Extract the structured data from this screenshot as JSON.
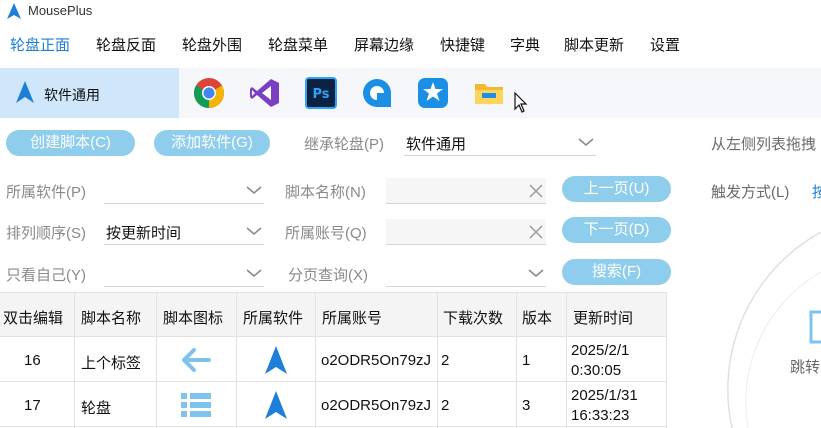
{
  "window": {
    "title": "MousePlus"
  },
  "menu": [
    {
      "label": "轮盘正面",
      "active": true
    },
    {
      "label": "轮盘反面"
    },
    {
      "label": "轮盘外围"
    },
    {
      "label": "轮盘菜单"
    },
    {
      "label": "屏幕边缘"
    },
    {
      "label": "快捷键"
    },
    {
      "label": "字典"
    },
    {
      "label": "脚本更新"
    },
    {
      "label": "设置"
    }
  ],
  "apps": {
    "selected_label": "软件通用",
    "items": [
      "chrome-icon",
      "visual-studio-icon",
      "photoshop-icon",
      "quicklook-icon",
      "baidu-netdisk-icon",
      "file-explorer-icon"
    ]
  },
  "toolbar": {
    "create_script": "创建脚本(C)",
    "add_software": "添加软件(G)",
    "inherit_label": "继承轮盘(P)",
    "inherit_value": "软件通用",
    "hint": "从左侧列表拖拽"
  },
  "filters": {
    "software_label": "所属软件(P)",
    "script_name_label": "脚本名称(N)",
    "prev_page": "上一页(U)",
    "trigger_label": "触发方式(L)",
    "trigger_value": "按",
    "sort_label": "排列顺序(S)",
    "sort_value": "按更新时间",
    "account_label": "所属账号(Q)",
    "next_page": "下一页(D)",
    "only_mine_label": "只看自己(Y)",
    "page_query_label": "分页查询(X)",
    "search": "搜索(F)"
  },
  "table": {
    "headers": [
      "双击编辑",
      "脚本名称",
      "脚本图标",
      "所属软件",
      "所属账号",
      "下载次数",
      "版本",
      "更新时间"
    ],
    "rows": [
      {
        "id": "16",
        "name": "上个标签",
        "icon": "arrow-left-icon",
        "account": "o2ODR5On79zJ",
        "downloads": "2",
        "version": "1",
        "updated_line1": "2025/2/1",
        "updated_line2": "0:30:05"
      },
      {
        "id": "17",
        "name": "轮盘",
        "icon": "list-icon",
        "account": "o2ODR5On79zJ",
        "downloads": "2",
        "version": "3",
        "updated_line1": "2025/1/31",
        "updated_line2": "16:33:23"
      }
    ]
  },
  "right_panel": {
    "label": "跳转"
  },
  "colors": {
    "accent": "#1e7fd8",
    "pill": "#8fcdec",
    "selected_bg": "#cfe6fb"
  }
}
